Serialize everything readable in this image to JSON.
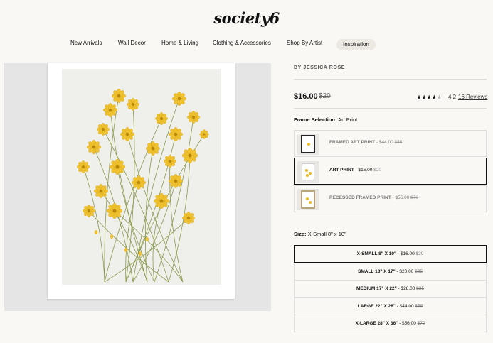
{
  "brand": {
    "logo": "society6"
  },
  "nav": {
    "items": [
      "New Arrivals",
      "Wall Decor",
      "Home & Living",
      "Clothing & Accessories",
      "Shop By Artist",
      "Inspiration"
    ]
  },
  "product": {
    "artist": "BY JESSICA ROSE",
    "price": "$16.00",
    "price_old": "$20",
    "rating_stars": 4,
    "rating": "4.2",
    "reviews": "16 Reviews"
  },
  "frame_selection": {
    "label": "Frame Selection:",
    "value": "Art Print",
    "options": [
      {
        "name": "FRAMED ART PRINT",
        "price": " - $44.00 ",
        "old": "$55",
        "selected": false
      },
      {
        "name": "ART PRINT",
        "price": " - $16.00 ",
        "old": "$20",
        "selected": true
      },
      {
        "name": "RECESSED FRAMED PRINT",
        "price": " - $56.00 ",
        "old": "$70",
        "selected": false
      }
    ]
  },
  "size_selection": {
    "label": "Size:",
    "value": "X-Small 8\" x 10\"",
    "options": [
      {
        "name": "X-SMALL 8\" X 10\"",
        "price": " - $16.00 ",
        "old": "$20",
        "selected": true
      },
      {
        "name": "SMALL 13\" X 17\"",
        "price": " - $20.00 ",
        "old": "$25",
        "selected": false
      },
      {
        "name": "MEDIUM 17\" X 22\"",
        "price": " - $28.00 ",
        "old": "$35",
        "selected": false
      },
      {
        "name": "LARGE 22\" X 28\"",
        "price": " - $44.00 ",
        "old": "$55",
        "selected": false
      },
      {
        "name": "X-LARGE 28\" X 36\"",
        "price": " - $56.00 ",
        "old": "$70",
        "selected": false
      }
    ]
  },
  "colors": {
    "flower": "#f0c12e",
    "flower_center": "#b8860b",
    "stem": "#8a9a4e"
  }
}
